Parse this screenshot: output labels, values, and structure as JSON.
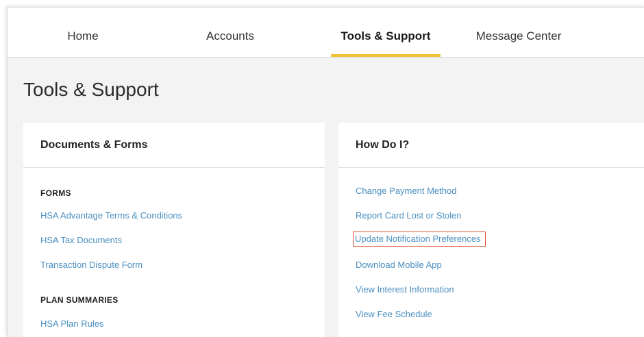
{
  "nav": {
    "tabs": [
      {
        "label": "Home"
      },
      {
        "label": "Accounts"
      },
      {
        "label": "Tools & Support"
      },
      {
        "label": "Message Center"
      }
    ],
    "active_color": "#f2c237"
  },
  "page": {
    "title": "Tools & Support"
  },
  "documents_card": {
    "title": "Documents & Forms",
    "forms_heading": "FORMS",
    "forms": [
      {
        "label": "HSA Advantage Terms & Conditions"
      },
      {
        "label": "HSA Tax Documents"
      },
      {
        "label": "Transaction Dispute Form"
      }
    ],
    "plan_heading": "PLAN SUMMARIES",
    "plans": [
      {
        "label": "HSA Plan Rules"
      }
    ]
  },
  "howdoi_card": {
    "title": "How Do I?",
    "links": [
      {
        "label": "Change Payment Method"
      },
      {
        "label": "Report Card Lost or Stolen"
      },
      {
        "label": "Update Notification Preferences"
      },
      {
        "label": "Download Mobile App"
      },
      {
        "label": "View Interest Information"
      },
      {
        "label": "View Fee Schedule"
      }
    ],
    "highlight_color": "#e0502e"
  },
  "colors": {
    "link": "#4a8fc0",
    "background": "#f3f3f3"
  }
}
